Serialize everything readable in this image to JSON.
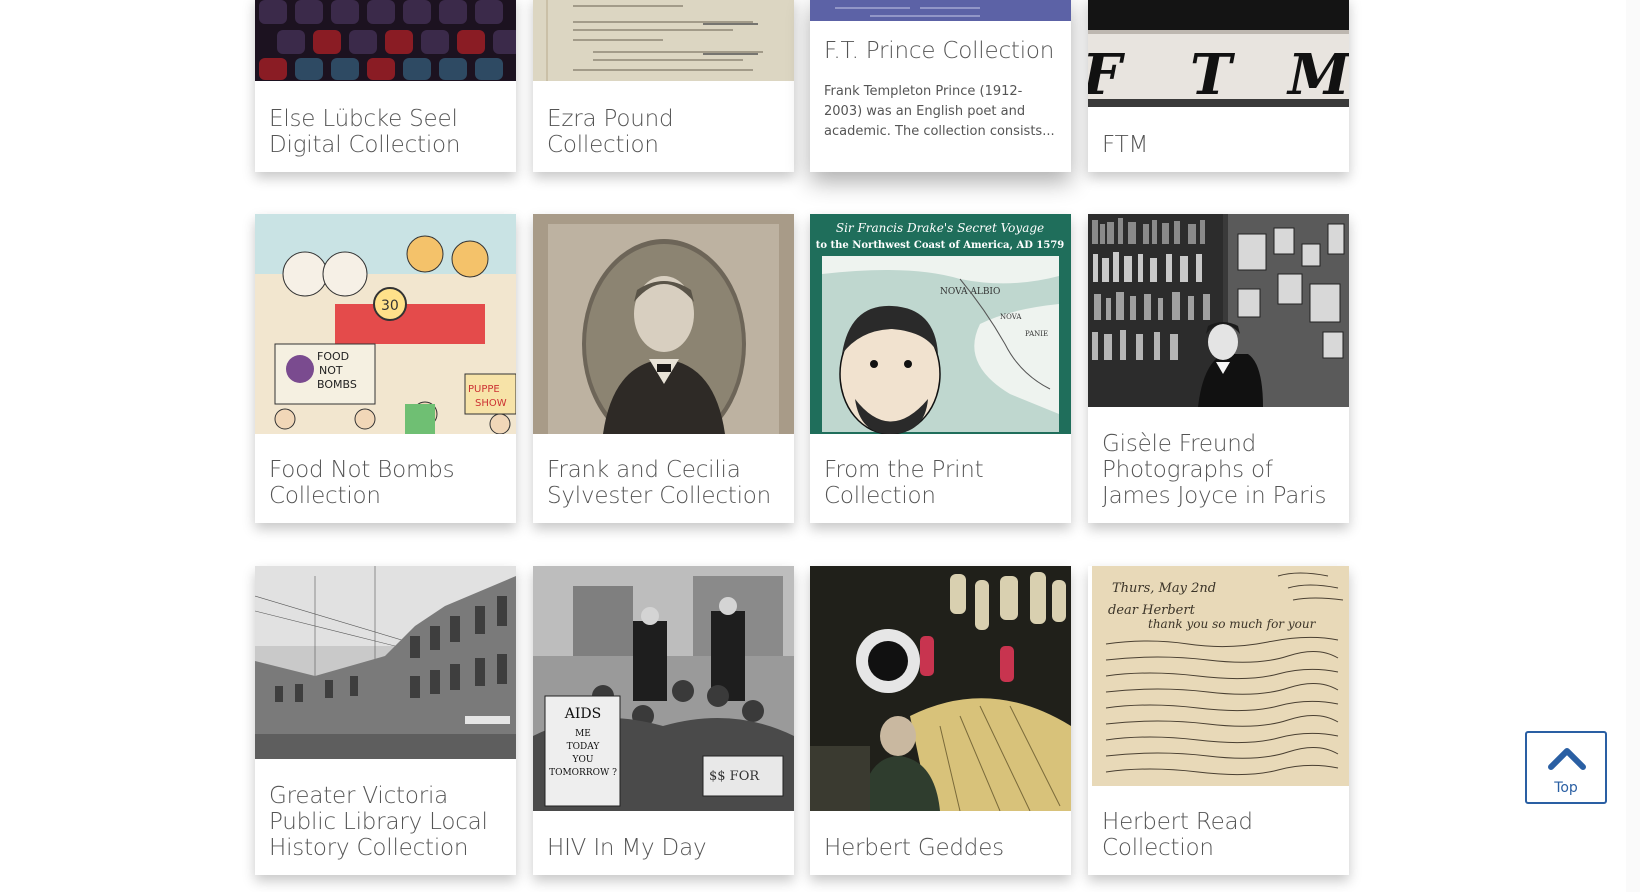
{
  "collections": [
    {
      "title": "Else Lübcke Seel Digital Collection",
      "image": "dark-quilt-pattern"
    },
    {
      "title": "Ezra Pound Collection",
      "image": "typescript-page"
    },
    {
      "title": "F.T. Prince Collection",
      "description": "Frank Templeton Prince (1912-2003) was an English poet and academic. The collection consists...",
      "image": "blue-document-strip"
    },
    {
      "title": "FTM",
      "image": "ftm-newsletter-masthead",
      "image_text": "F T M"
    },
    {
      "title": "Food Not Bombs Collection",
      "image": "food-not-bombs-illustration",
      "image_text": "FOOD NOT BOMBS"
    },
    {
      "title": "Frank and Cecilia Sylvester Collection",
      "image": "sepia-portrait"
    },
    {
      "title": "From the Print Collection",
      "image": "drake-secret-voyage-map",
      "image_text_line1": "Sir Francis Drake's  Secret Voyage",
      "image_text_line2": "to the Northwest Coast of America, AD 1579",
      "map_labels": [
        "NOVA ALBIO",
        "NOVA",
        "PANIE"
      ]
    },
    {
      "title": "Gisèle Freund Photographs of James Joyce in Paris",
      "image": "bookshelf-photograph"
    },
    {
      "title": "Greater Victoria Public Library Local History Collection",
      "image": "historic-street-photo"
    },
    {
      "title": "HIV In My Day",
      "image": "aids-protest-photo",
      "sign_text": [
        "AIDS",
        "ME",
        "TODAY",
        "YOU",
        "TOMORROW ?"
      ]
    },
    {
      "title": "Herbert Geddes",
      "image": "lantern-shop-photo"
    },
    {
      "title": "Herbert Read Collection",
      "image": "handwritten-letter",
      "letter_text": [
        "Thurs, May 2nd",
        "dear Herbert",
        "thank you so much for your"
      ]
    }
  ],
  "back_to_top": {
    "label": "Top",
    "icon": "chevron-up-icon"
  },
  "colors": {
    "accent": "#2a5fa3",
    "map_green": "#1f6e5b",
    "text": "#555555"
  }
}
